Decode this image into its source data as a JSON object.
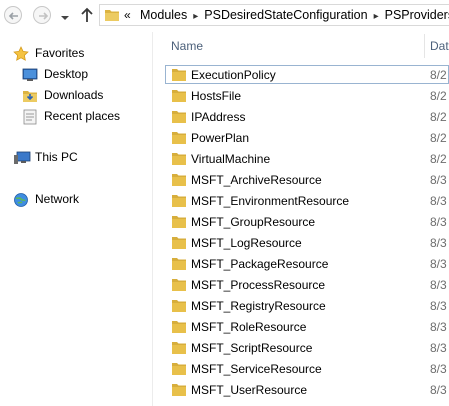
{
  "colors": {
    "folder": "#e8c04a",
    "header_text": "#4c607a",
    "selection_border": "#99b4d1"
  },
  "address": {
    "overflow": "«",
    "crumbs": [
      "Modules",
      "PSDesiredStateConfiguration",
      "PSProviders"
    ]
  },
  "navpane": {
    "favorites_label": "Favorites",
    "desktop_label": "Desktop",
    "downloads_label": "Downloads",
    "recent_label": "Recent places",
    "thispc_label": "This PC",
    "network_label": "Network"
  },
  "columns": {
    "name": "Name",
    "date": "Dat"
  },
  "files": [
    {
      "name": "ExecutionPolicy",
      "date": "8/2",
      "selected": true
    },
    {
      "name": "HostsFile",
      "date": "8/2"
    },
    {
      "name": "IPAddress",
      "date": "8/2"
    },
    {
      "name": "PowerPlan",
      "date": "8/2"
    },
    {
      "name": "VirtualMachine",
      "date": "8/2"
    },
    {
      "name": "MSFT_ArchiveResource",
      "date": "8/3"
    },
    {
      "name": "MSFT_EnvironmentResource",
      "date": "8/3"
    },
    {
      "name": "MSFT_GroupResource",
      "date": "8/3"
    },
    {
      "name": "MSFT_LogResource",
      "date": "8/3"
    },
    {
      "name": "MSFT_PackageResource",
      "date": "8/3"
    },
    {
      "name": "MSFT_ProcessResource",
      "date": "8/3"
    },
    {
      "name": "MSFT_RegistryResource",
      "date": "8/3"
    },
    {
      "name": "MSFT_RoleResource",
      "date": "8/3"
    },
    {
      "name": "MSFT_ScriptResource",
      "date": "8/3"
    },
    {
      "name": "MSFT_ServiceResource",
      "date": "8/3"
    },
    {
      "name": "MSFT_UserResource",
      "date": "8/3"
    }
  ]
}
